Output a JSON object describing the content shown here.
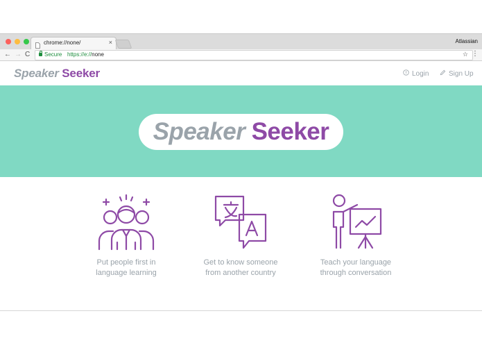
{
  "browser": {
    "tab_title": "chrome://none/",
    "tab_close": "×",
    "profile_name": "Atlassian",
    "secure_label": "Secure",
    "url_scheme": "https://e://",
    "url_rest": "none",
    "back_glyph": "←",
    "forward_glyph": "→",
    "reload_glyph": "C",
    "star_glyph": "☆",
    "menu_glyph": "⋮"
  },
  "site": {
    "logo_part1": "Speaker",
    "logo_part2": "Seeker",
    "nav": {
      "login_label": "Login",
      "signup_label": "Sign Up"
    }
  },
  "hero": {
    "title_part1": "Speaker",
    "title_part2": "Seeker",
    "background": "#80d9c3"
  },
  "features": [
    {
      "icon": "people-group-icon",
      "line1": "Put people first in",
      "line2": "language learning"
    },
    {
      "icon": "translate-icon",
      "line1": "Get to know someone",
      "line2": "from another country"
    },
    {
      "icon": "teacher-presentation-icon",
      "line1": "Teach your language",
      "line2": "through conversation"
    }
  ],
  "colors": {
    "brand_purple": "#8e4aa6",
    "brand_gray": "#9aa3aa",
    "hero_teal": "#80d9c3"
  }
}
